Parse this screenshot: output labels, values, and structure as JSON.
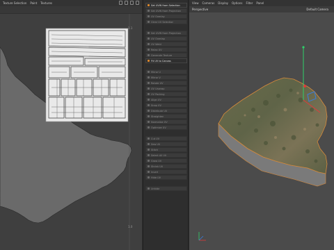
{
  "uv_editor": {
    "menu": [
      "Texture Selection",
      "Paint",
      "Textures"
    ],
    "ticks": {
      "top_right": "1.1",
      "bottom_right": "1.0"
    }
  },
  "uv_commands": {
    "items": [
      "Set UVW from Selection",
      "Set UVW from Projection",
      "UV Overlay",
      "Clear UV Selection",
      "Set UVW from Projection",
      "UV Overlap",
      "UV Weld",
      "Relax UV",
      "Generate Texture",
      "Fit UV to Canvas",
      "Mirror U",
      "Mirror V",
      "Rotate UV",
      "UV Unwrap",
      "UV Packing",
      "Align UV",
      "Snap UV",
      "Distribute UV",
      "Straighten",
      "Normalize UV",
      "Optimize UV",
      "Cut UV",
      "Sew UV",
      "Stitch",
      "Select All UV",
      "Grow UV",
      "Shrink UV",
      "Invert",
      "Hide UV",
      "Unhide"
    ]
  },
  "viewport": {
    "menu": [
      "View",
      "Cameras",
      "Display",
      "Options",
      "Filter",
      "Panel"
    ],
    "label": "Perspective",
    "camera": "Default Camera"
  },
  "colors": {
    "accent": "#e08a2c",
    "axis_y": "#2fd06a",
    "axis_x": "#e03a3a",
    "axis_z": "#3a7de0"
  }
}
